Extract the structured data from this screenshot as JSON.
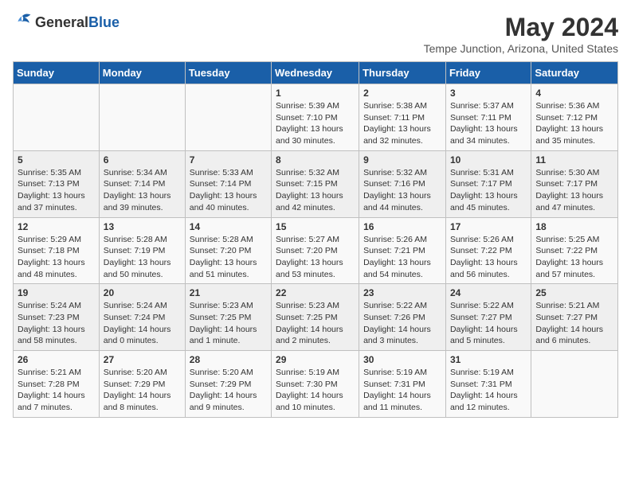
{
  "header": {
    "logo_general": "General",
    "logo_blue": "Blue",
    "month_year": "May 2024",
    "location": "Tempe Junction, Arizona, United States"
  },
  "days_of_week": [
    "Sunday",
    "Monday",
    "Tuesday",
    "Wednesday",
    "Thursday",
    "Friday",
    "Saturday"
  ],
  "weeks": [
    {
      "cells": [
        {
          "day": null,
          "info": null
        },
        {
          "day": null,
          "info": null
        },
        {
          "day": null,
          "info": null
        },
        {
          "day": "1",
          "info": "Sunrise: 5:39 AM\nSunset: 7:10 PM\nDaylight: 13 hours\nand 30 minutes."
        },
        {
          "day": "2",
          "info": "Sunrise: 5:38 AM\nSunset: 7:11 PM\nDaylight: 13 hours\nand 32 minutes."
        },
        {
          "day": "3",
          "info": "Sunrise: 5:37 AM\nSunset: 7:11 PM\nDaylight: 13 hours\nand 34 minutes."
        },
        {
          "day": "4",
          "info": "Sunrise: 5:36 AM\nSunset: 7:12 PM\nDaylight: 13 hours\nand 35 minutes."
        }
      ]
    },
    {
      "cells": [
        {
          "day": "5",
          "info": "Sunrise: 5:35 AM\nSunset: 7:13 PM\nDaylight: 13 hours\nand 37 minutes."
        },
        {
          "day": "6",
          "info": "Sunrise: 5:34 AM\nSunset: 7:14 PM\nDaylight: 13 hours\nand 39 minutes."
        },
        {
          "day": "7",
          "info": "Sunrise: 5:33 AM\nSunset: 7:14 PM\nDaylight: 13 hours\nand 40 minutes."
        },
        {
          "day": "8",
          "info": "Sunrise: 5:32 AM\nSunset: 7:15 PM\nDaylight: 13 hours\nand 42 minutes."
        },
        {
          "day": "9",
          "info": "Sunrise: 5:32 AM\nSunset: 7:16 PM\nDaylight: 13 hours\nand 44 minutes."
        },
        {
          "day": "10",
          "info": "Sunrise: 5:31 AM\nSunset: 7:17 PM\nDaylight: 13 hours\nand 45 minutes."
        },
        {
          "day": "11",
          "info": "Sunrise: 5:30 AM\nSunset: 7:17 PM\nDaylight: 13 hours\nand 47 minutes."
        }
      ]
    },
    {
      "cells": [
        {
          "day": "12",
          "info": "Sunrise: 5:29 AM\nSunset: 7:18 PM\nDaylight: 13 hours\nand 48 minutes."
        },
        {
          "day": "13",
          "info": "Sunrise: 5:28 AM\nSunset: 7:19 PM\nDaylight: 13 hours\nand 50 minutes."
        },
        {
          "day": "14",
          "info": "Sunrise: 5:28 AM\nSunset: 7:20 PM\nDaylight: 13 hours\nand 51 minutes."
        },
        {
          "day": "15",
          "info": "Sunrise: 5:27 AM\nSunset: 7:20 PM\nDaylight: 13 hours\nand 53 minutes."
        },
        {
          "day": "16",
          "info": "Sunrise: 5:26 AM\nSunset: 7:21 PM\nDaylight: 13 hours\nand 54 minutes."
        },
        {
          "day": "17",
          "info": "Sunrise: 5:26 AM\nSunset: 7:22 PM\nDaylight: 13 hours\nand 56 minutes."
        },
        {
          "day": "18",
          "info": "Sunrise: 5:25 AM\nSunset: 7:22 PM\nDaylight: 13 hours\nand 57 minutes."
        }
      ]
    },
    {
      "cells": [
        {
          "day": "19",
          "info": "Sunrise: 5:24 AM\nSunset: 7:23 PM\nDaylight: 13 hours\nand 58 minutes."
        },
        {
          "day": "20",
          "info": "Sunrise: 5:24 AM\nSunset: 7:24 PM\nDaylight: 14 hours\nand 0 minutes."
        },
        {
          "day": "21",
          "info": "Sunrise: 5:23 AM\nSunset: 7:25 PM\nDaylight: 14 hours\nand 1 minute."
        },
        {
          "day": "22",
          "info": "Sunrise: 5:23 AM\nSunset: 7:25 PM\nDaylight: 14 hours\nand 2 minutes."
        },
        {
          "day": "23",
          "info": "Sunrise: 5:22 AM\nSunset: 7:26 PM\nDaylight: 14 hours\nand 3 minutes."
        },
        {
          "day": "24",
          "info": "Sunrise: 5:22 AM\nSunset: 7:27 PM\nDaylight: 14 hours\nand 5 minutes."
        },
        {
          "day": "25",
          "info": "Sunrise: 5:21 AM\nSunset: 7:27 PM\nDaylight: 14 hours\nand 6 minutes."
        }
      ]
    },
    {
      "cells": [
        {
          "day": "26",
          "info": "Sunrise: 5:21 AM\nSunset: 7:28 PM\nDaylight: 14 hours\nand 7 minutes."
        },
        {
          "day": "27",
          "info": "Sunrise: 5:20 AM\nSunset: 7:29 PM\nDaylight: 14 hours\nand 8 minutes."
        },
        {
          "day": "28",
          "info": "Sunrise: 5:20 AM\nSunset: 7:29 PM\nDaylight: 14 hours\nand 9 minutes."
        },
        {
          "day": "29",
          "info": "Sunrise: 5:19 AM\nSunset: 7:30 PM\nDaylight: 14 hours\nand 10 minutes."
        },
        {
          "day": "30",
          "info": "Sunrise: 5:19 AM\nSunset: 7:31 PM\nDaylight: 14 hours\nand 11 minutes."
        },
        {
          "day": "31",
          "info": "Sunrise: 5:19 AM\nSunset: 7:31 PM\nDaylight: 14 hours\nand 12 minutes."
        },
        {
          "day": null,
          "info": null
        }
      ]
    }
  ]
}
